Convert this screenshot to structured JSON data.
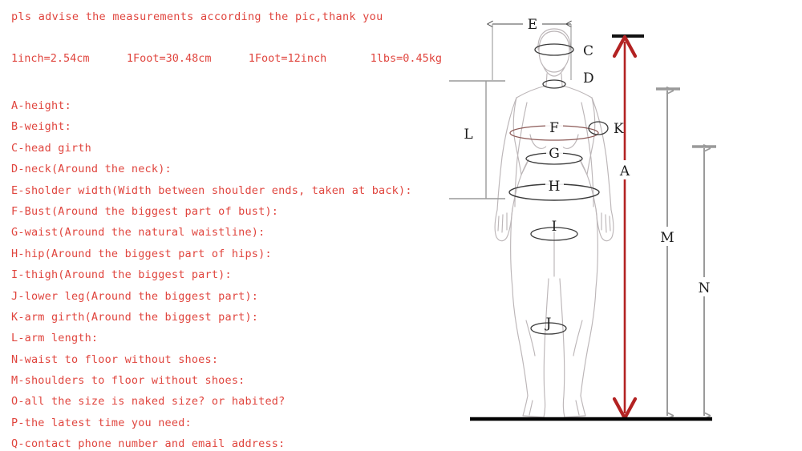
{
  "intro": "pls advise the measurements according the pic,thank you",
  "conversions": [
    "1inch=2.54cm",
    "1Foot=30.48cm",
    "1Foot=12inch",
    "1lbs=0.45kg"
  ],
  "measurements": [
    {
      "key": "A",
      "text": "A-height:"
    },
    {
      "key": "B",
      "text": "B-weight:"
    },
    {
      "key": "C",
      "text": "C-head girth"
    },
    {
      "key": "D",
      "text": "D-neck(Around the neck):"
    },
    {
      "key": "E",
      "text": "E-sholder width(Width between shoulder ends, taken at back):"
    },
    {
      "key": "F",
      "text": "F-Bust(Around the biggest part of bust):"
    },
    {
      "key": "G",
      "text": "G-waist(Around the natural waistline):"
    },
    {
      "key": "H",
      "text": "H-hip(Around the biggest part of hips):"
    },
    {
      "key": "I",
      "text": "I-thigh(Around the biggest part):"
    },
    {
      "key": "J",
      "text": "J-lower leg(Around the biggest part):"
    },
    {
      "key": "K",
      "text": "K-arm girth(Around the biggest part):"
    },
    {
      "key": "L",
      "text": "L-arm length:"
    },
    {
      "key": "N",
      "text": "N-waist to floor without shoes:"
    },
    {
      "key": "M",
      "text": "M-shoulders to floor without shoes:"
    },
    {
      "key": "O",
      "text": "O-all the size is naked size? or habited?"
    },
    {
      "key": "P",
      "text": "P-the latest time you need:"
    },
    {
      "key": "Q",
      "text": "Q-contact phone number and email address:"
    }
  ],
  "diagram": {
    "labels": {
      "E": "E",
      "C": "C",
      "D": "D",
      "F": "F",
      "K": "K",
      "G": "G",
      "H": "H",
      "I": "I",
      "J": "J",
      "L": "L",
      "A": "A",
      "M": "M",
      "N": "N"
    }
  },
  "colors": {
    "text_red": "#e0453e",
    "arrow_red": "#b32222",
    "arrow_gray": "#9a9a9a",
    "figure_gray": "#b9b4b6",
    "ellipse_dark": "#3a3a3a",
    "ground_black": "#000000"
  }
}
